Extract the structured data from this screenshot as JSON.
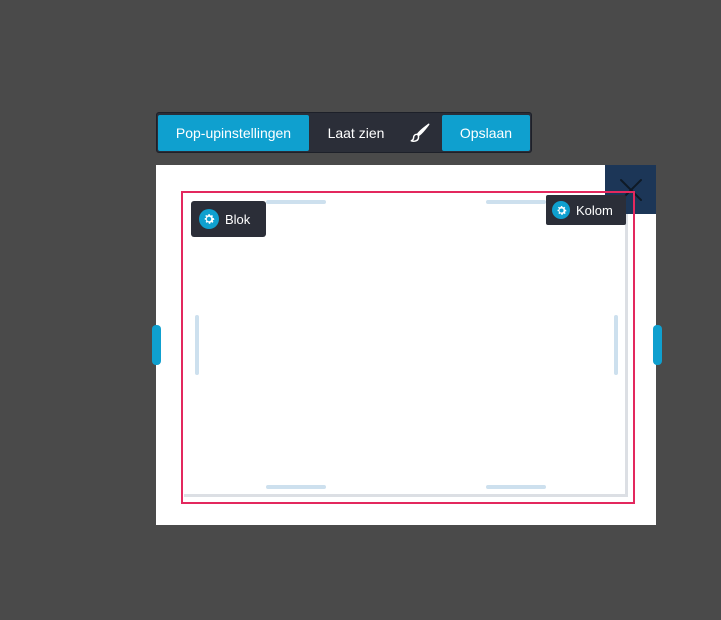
{
  "toolbar": {
    "settings_label": "Pop-upinstellingen",
    "show_label": "Laat zien",
    "brush_icon": "brush-icon",
    "save_label": "Opslaan"
  },
  "popup": {
    "close_icon": "close-icon",
    "block_label": "Blok",
    "column_label": "Kolom"
  },
  "colors": {
    "background": "#4a4a4a",
    "accent": "#0fa0cf",
    "toolbar_bg": "#2b2e38",
    "close_bg": "#1c3657",
    "selection_border": "#e3285e",
    "resize_handle": "#cde0ee"
  }
}
